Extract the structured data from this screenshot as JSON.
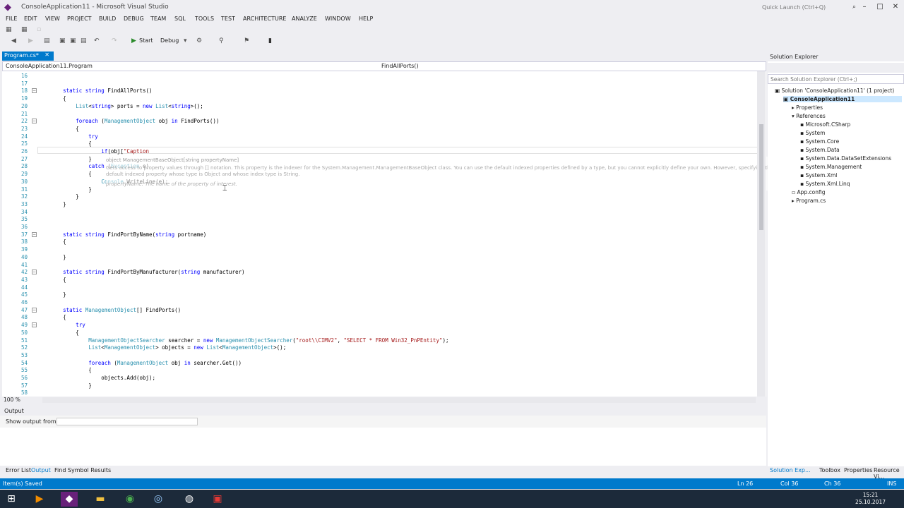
{
  "titlebar": {
    "title": "ConsoleApplication11 - Microsoft Visual Studio",
    "quick_launch": "Quick Launch (Ctrl+Q)"
  },
  "menu": [
    "FILE",
    "EDIT",
    "VIEW",
    "PROJECT",
    "BUILD",
    "DEBUG",
    "TEAM",
    "SQL",
    "TOOLS",
    "TEST",
    "ARCHITECTURE",
    "ANALYZE",
    "WINDOW",
    "HELP"
  ],
  "toolbar": {
    "start": "Start",
    "config": "Debug"
  },
  "doc_tab": {
    "label": "Program.cs*"
  },
  "navbar": {
    "left": "ConsoleApplication11.Program",
    "right": "FindAllPorts()"
  },
  "editor": {
    "zoom": "100 %",
    "lines": [
      {
        "n": "16",
        "t": ""
      },
      {
        "n": "17",
        "t": ""
      },
      {
        "n": "18",
        "t": "        static string FindAllPorts()"
      },
      {
        "n": "19",
        "t": "        {"
      },
      {
        "n": "20",
        "t": "            List<string> ports = new List<string>();"
      },
      {
        "n": "21",
        "t": ""
      },
      {
        "n": "22",
        "t": "            foreach (ManagementObject obj in FindPorts())"
      },
      {
        "n": "23",
        "t": "            {"
      },
      {
        "n": "24",
        "t": "                try"
      },
      {
        "n": "25",
        "t": "                {"
      },
      {
        "n": "26",
        "t": "                    if(obj[\"Caption"
      },
      {
        "n": "27",
        "t": "                }"
      },
      {
        "n": "28",
        "t": "                catch (Exception e)"
      },
      {
        "n": "29",
        "t": "                {"
      },
      {
        "n": "30",
        "t": "                    Console.WriteLine(e);"
      },
      {
        "n": "31",
        "t": "                }"
      },
      {
        "n": "32",
        "t": "            }"
      },
      {
        "n": "33",
        "t": "        }"
      },
      {
        "n": "34",
        "t": ""
      },
      {
        "n": "35",
        "t": ""
      },
      {
        "n": "36",
        "t": ""
      },
      {
        "n": "37",
        "t": "        static string FindPortByName(string portname)"
      },
      {
        "n": "38",
        "t": "        {"
      },
      {
        "n": "39",
        "t": ""
      },
      {
        "n": "40",
        "t": "        }"
      },
      {
        "n": "41",
        "t": ""
      },
      {
        "n": "42",
        "t": "        static string FindPortByManufacturer(string manufacturer)"
      },
      {
        "n": "43",
        "t": "        {"
      },
      {
        "n": "44",
        "t": ""
      },
      {
        "n": "45",
        "t": "        }"
      },
      {
        "n": "46",
        "t": ""
      },
      {
        "n": "47",
        "t": "        static ManagementObject[] FindPorts()"
      },
      {
        "n": "48",
        "t": "        {"
      },
      {
        "n": "49",
        "t": "            try"
      },
      {
        "n": "50",
        "t": "            {"
      },
      {
        "n": "51",
        "t": "                ManagementObjectSearcher searcher = new ManagementObjectSearcher(\"root\\\\CIMV2\", \"SELECT * FROM Win32_PnPEntity\");"
      },
      {
        "n": "52",
        "t": "                List<ManagementObject> objects = new List<ManagementObject>();"
      },
      {
        "n": "53",
        "t": ""
      },
      {
        "n": "54",
        "t": "                foreach (ManagementObject obj in searcher.Get())"
      },
      {
        "n": "55",
        "t": "                {"
      },
      {
        "n": "56",
        "t": "                    objects.Add(obj);"
      },
      {
        "n": "57",
        "t": "                }"
      },
      {
        "n": "58",
        "t": ""
      }
    ]
  },
  "tooltip": {
    "sig": "object ManagementBaseObject[string propertyName]",
    "desc1": "Gets access to property values through [] notation. This property is the indexer for the System.Management.ManagementBaseObject class. You can use the default indexed properties defined by a type, but you cannot explicitly define your own. However, specifying the expando attribute on a class automatically provides a",
    "desc2": "default indexed property whose type is Object and whose index type is String.",
    "param": "propertyName: The name of the property of interest."
  },
  "output": {
    "title": "Output",
    "show_label": "Show output from:"
  },
  "bottom_tabs": [
    "Error List",
    "Output",
    "Find Symbol Results"
  ],
  "solution": {
    "title": "Solution Explorer",
    "search": "Search Solution Explorer (Ctrl+;)",
    "items": [
      "Solution 'ConsoleApplication11' (1 project)",
      "ConsoleApplication11",
      "Properties",
      "References",
      "Microsoft.CSharp",
      "System",
      "System.Core",
      "System.Data",
      "System.Data.DataSetExtensions",
      "System.Management",
      "System.Xml",
      "System.Xml.Linq",
      "App.config",
      "Program.cs"
    ],
    "tabs": [
      "Solution Exp...",
      "Toolbox",
      "Properties",
      "Resource Vi..."
    ]
  },
  "status": {
    "msg": "Item(s) Saved",
    "ln": "Ln 26",
    "col": "Col 36",
    "ch": "Ch 36",
    "ins": "INS"
  },
  "clock": {
    "time": "15:21",
    "date": "25.10.2017"
  }
}
